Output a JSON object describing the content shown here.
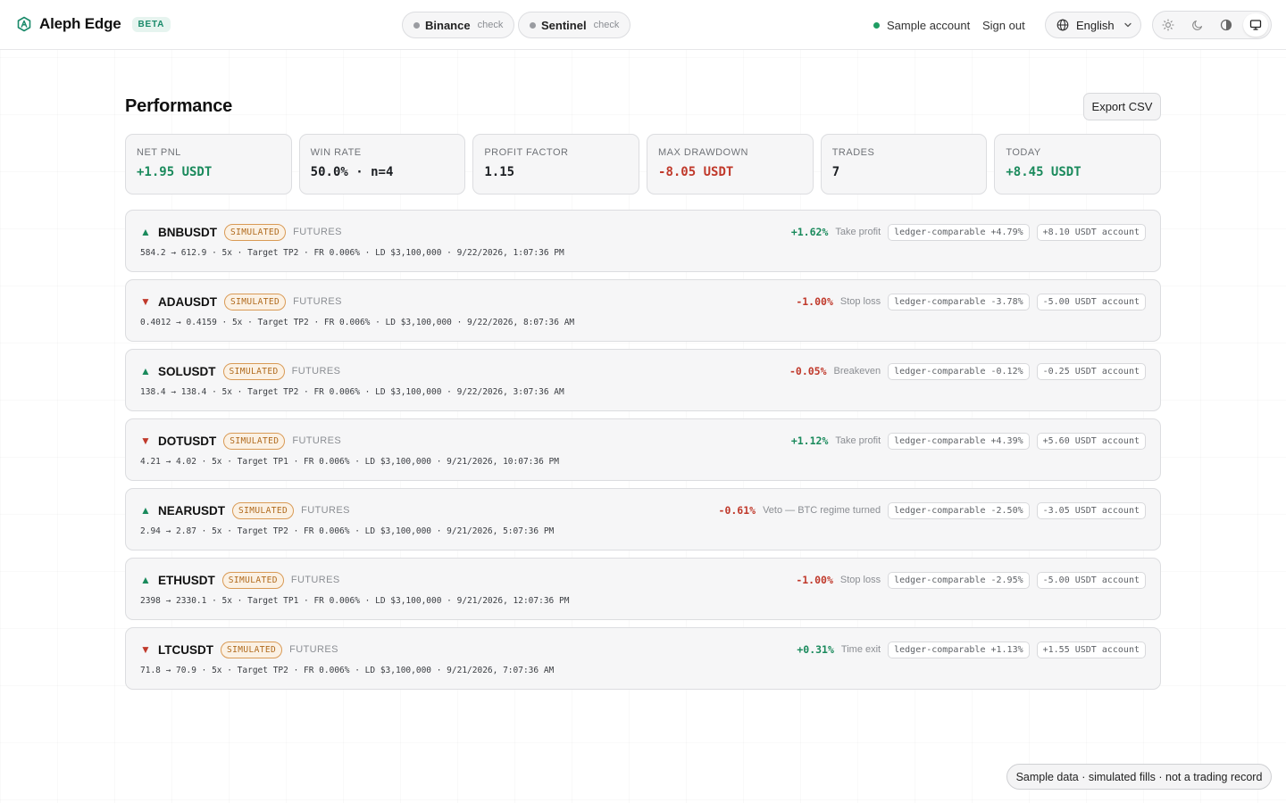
{
  "header": {
    "brand": "Aleph Edge",
    "badge": "BETA",
    "connections": [
      {
        "name": "Binance",
        "status": "check"
      },
      {
        "name": "Sentinel",
        "status": "check"
      }
    ],
    "account_label": "Sample account",
    "signout_label": "Sign out",
    "language": "English",
    "theme_options": [
      "light",
      "dark",
      "contrast",
      "system"
    ],
    "active_theme": "system"
  },
  "page": {
    "title": "Performance",
    "export_label": "Export CSV"
  },
  "stats": [
    {
      "label": "NET PNL",
      "value": "+1.95 USDT",
      "tone": "pos"
    },
    {
      "label": "WIN RATE",
      "value": "50.0% · n=4",
      "tone": "neutral"
    },
    {
      "label": "PROFIT FACTOR",
      "value": "1.15",
      "tone": "neutral"
    },
    {
      "label": "MAX DRAWDOWN",
      "value": "-8.05 USDT",
      "tone": "neg"
    },
    {
      "label": "TRADES",
      "value": "7",
      "tone": "neutral"
    },
    {
      "label": "TODAY",
      "value": "+8.45 USDT",
      "tone": "pos"
    }
  ],
  "trades": [
    {
      "direction": "up",
      "symbol": "BNBUSDT",
      "badge": "SIMULATED",
      "market": "FUTURES",
      "meta": "584.2 → 612.9 · 5x · Target TP2 · FR 0.006% · LD $3,100,000 · 9/22/2026, 1:07:36 PM",
      "pct": "+1.62%",
      "tone": "pos",
      "reason": "Take profit",
      "ledger": "ledger-comparable +4.79%",
      "account": "+8.10 USDT account"
    },
    {
      "direction": "down",
      "symbol": "ADAUSDT",
      "badge": "SIMULATED",
      "market": "FUTURES",
      "meta": "0.4012 → 0.4159 · 5x · Target TP2 · FR 0.006% · LD $3,100,000 · 9/22/2026, 8:07:36 AM",
      "pct": "-1.00%",
      "tone": "neg",
      "reason": "Stop loss",
      "ledger": "ledger-comparable -3.78%",
      "account": "-5.00 USDT account"
    },
    {
      "direction": "up",
      "symbol": "SOLUSDT",
      "badge": "SIMULATED",
      "market": "FUTURES",
      "meta": "138.4 → 138.4 · 5x · Target TP2 · FR 0.006% · LD $3,100,000 · 9/22/2026, 3:07:36 AM",
      "pct": "-0.05%",
      "tone": "neg",
      "reason": "Breakeven",
      "ledger": "ledger-comparable -0.12%",
      "account": "-0.25 USDT account"
    },
    {
      "direction": "down",
      "symbol": "DOTUSDT",
      "badge": "SIMULATED",
      "market": "FUTURES",
      "meta": "4.21 → 4.02 · 5x · Target TP1 · FR 0.006% · LD $3,100,000 · 9/21/2026, 10:07:36 PM",
      "pct": "+1.12%",
      "tone": "pos",
      "reason": "Take profit",
      "ledger": "ledger-comparable +4.39%",
      "account": "+5.60 USDT account"
    },
    {
      "direction": "up",
      "symbol": "NEARUSDT",
      "badge": "SIMULATED",
      "market": "FUTURES",
      "meta": "2.94 → 2.87 · 5x · Target TP2 · FR 0.006% · LD $3,100,000 · 9/21/2026, 5:07:36 PM",
      "pct": "-0.61%",
      "tone": "neg",
      "reason": "Veto — BTC regime turned",
      "ledger": "ledger-comparable -2.50%",
      "account": "-3.05 USDT account"
    },
    {
      "direction": "up",
      "symbol": "ETHUSDT",
      "badge": "SIMULATED",
      "market": "FUTURES",
      "meta": "2398 → 2330.1 · 5x · Target TP1 · FR 0.006% · LD $3,100,000 · 9/21/2026, 12:07:36 PM",
      "pct": "-1.00%",
      "tone": "neg",
      "reason": "Stop loss",
      "ledger": "ledger-comparable -2.95%",
      "account": "-5.00 USDT account"
    },
    {
      "direction": "down",
      "symbol": "LTCUSDT",
      "badge": "SIMULATED",
      "market": "FUTURES",
      "meta": "71.8 → 70.9 · 5x · Target TP2 · FR 0.006% · LD $3,100,000 · 9/21/2026, 7:07:36 AM",
      "pct": "+0.31%",
      "tone": "pos",
      "reason": "Time exit",
      "ledger": "ledger-comparable +1.13%",
      "account": "+1.55 USDT account"
    }
  ],
  "footer": {
    "notice": "Sample data · simulated fills · not a trading record"
  },
  "colors": {
    "positive": "#1a8a5c",
    "negative": "#c0392b",
    "brand_accent": "#1a8a6a",
    "simulated_badge": "#b06a1d"
  }
}
